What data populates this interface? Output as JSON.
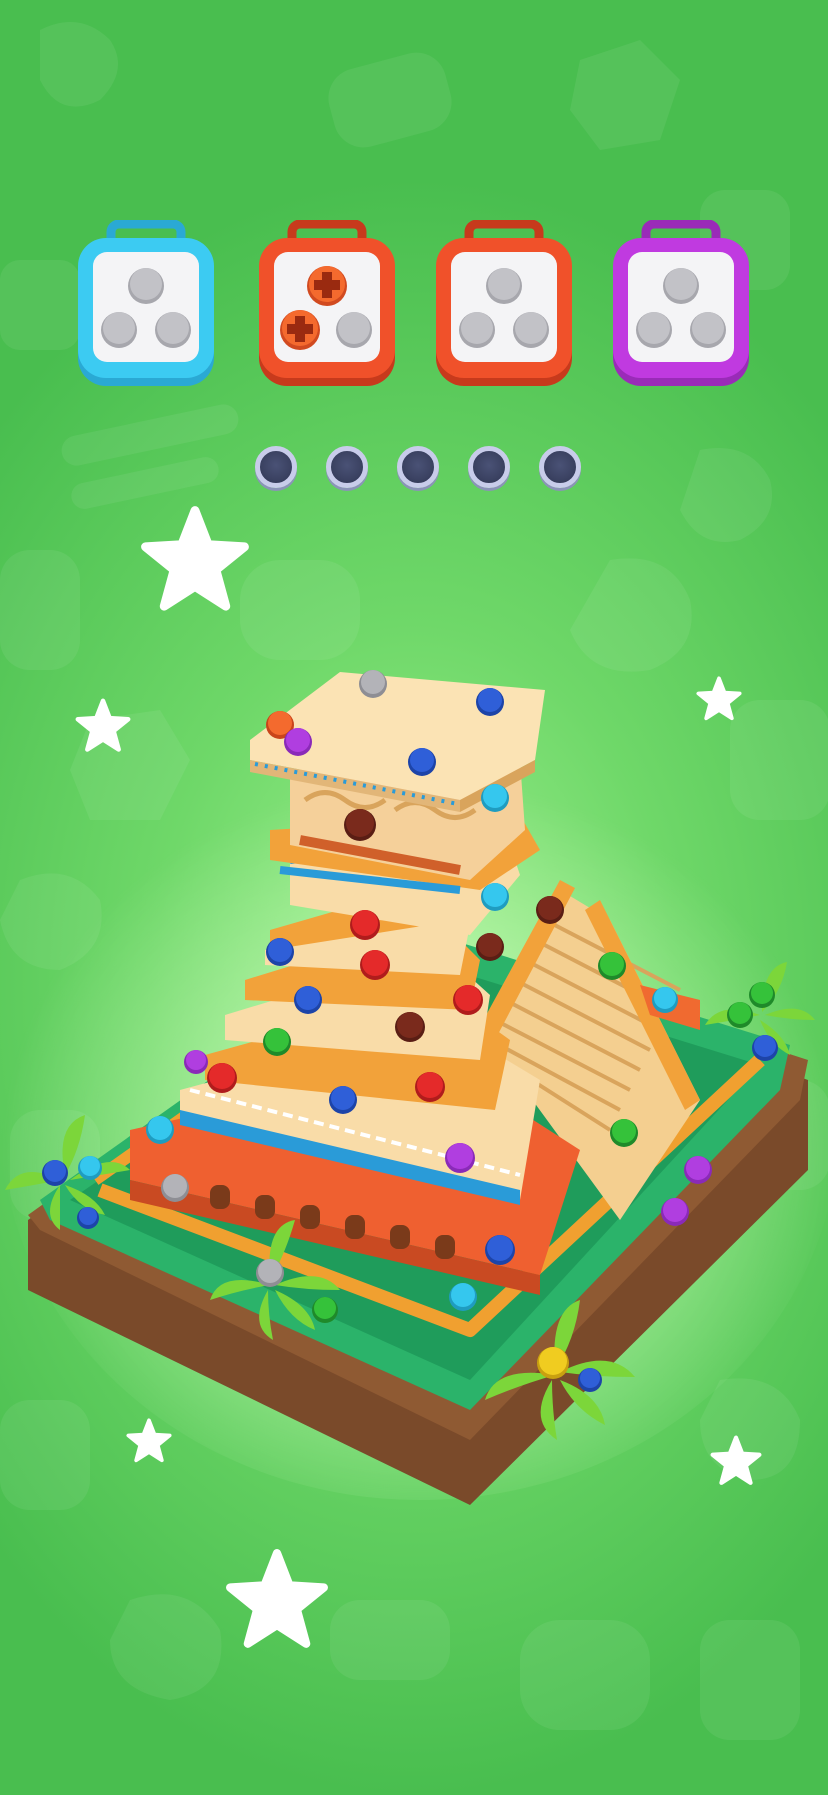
{
  "colors": {
    "background": "#6fd869",
    "box_blue": "#35c7ee",
    "box_red": "#f0512a",
    "box_purple": "#c03ae0",
    "slot_empty": "#3b4262"
  },
  "boxes": [
    {
      "color": "blue",
      "filled": 0,
      "capacity": 3
    },
    {
      "color": "red",
      "filled": 2,
      "capacity": 3
    },
    {
      "color": "red",
      "filled": 0,
      "capacity": 3
    },
    {
      "color": "purple",
      "filled": 0,
      "capacity": 3
    }
  ],
  "holding_slots": {
    "total": 5,
    "filled": 0
  },
  "level_object": "pyramid-temple",
  "decorations": [
    "star-icon",
    "star-icon",
    "star-icon",
    "star-icon",
    "star-icon",
    "star-icon"
  ]
}
